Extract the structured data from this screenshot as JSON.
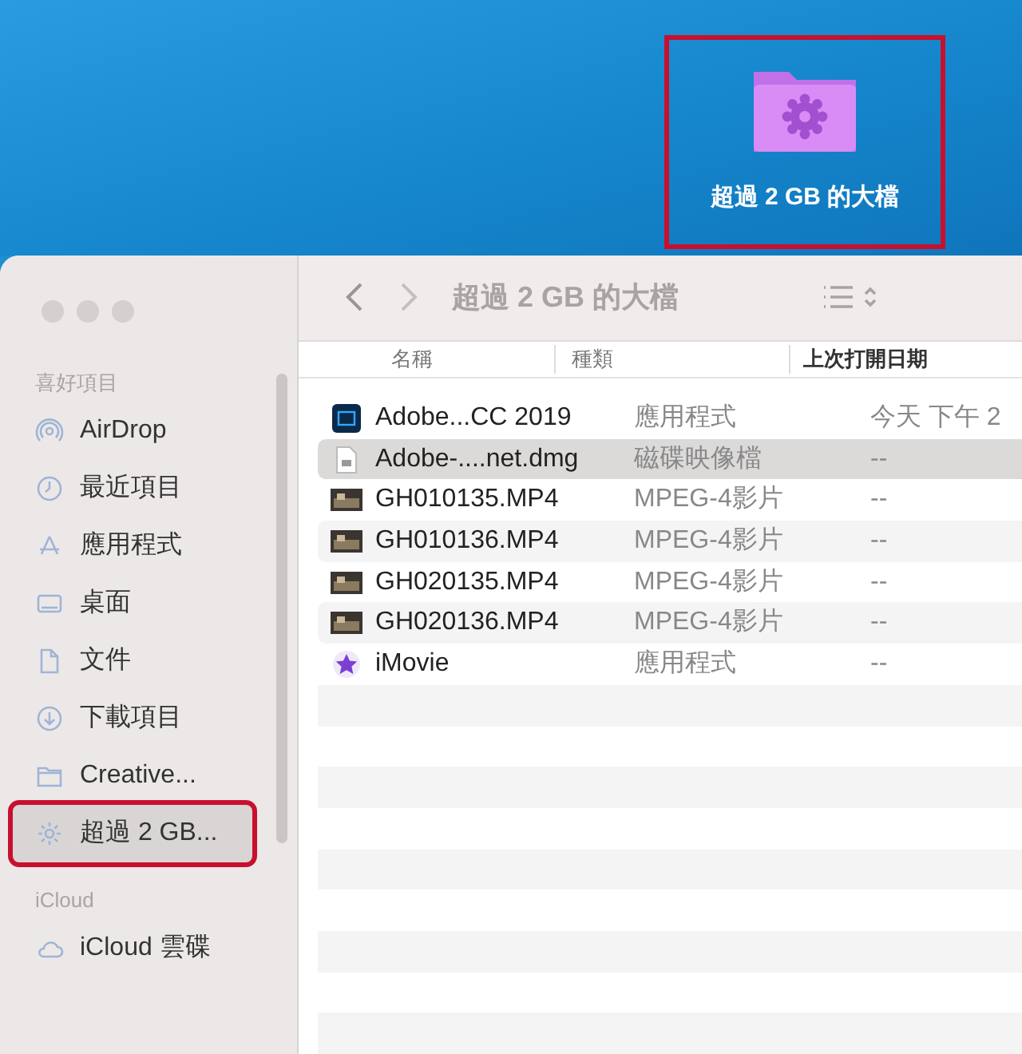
{
  "desktop": {
    "folder": {
      "label": "超過 2 GB 的大檔",
      "highlighted": true
    }
  },
  "window": {
    "title": "超過 2 GB 的大檔"
  },
  "sidebar": {
    "sections": [
      {
        "heading": "喜好項目",
        "items": [
          {
            "label": "AirDrop",
            "selected": false,
            "highlighted": false
          },
          {
            "label": "最近項目",
            "selected": false,
            "highlighted": false
          },
          {
            "label": "應用程式",
            "selected": false,
            "highlighted": false
          },
          {
            "label": "桌面",
            "selected": false,
            "highlighted": false
          },
          {
            "label": "文件",
            "selected": false,
            "highlighted": false
          },
          {
            "label": "下載項目",
            "selected": false,
            "highlighted": false
          },
          {
            "label": "Creative...",
            "selected": false,
            "highlighted": false
          },
          {
            "label": "超過 2 GB...",
            "selected": true,
            "highlighted": true
          }
        ]
      },
      {
        "heading": "iCloud",
        "items": [
          {
            "label": "iCloud 雲碟",
            "selected": false,
            "highlighted": false
          }
        ]
      }
    ]
  },
  "table": {
    "columns": [
      "名稱",
      "種類",
      "上次打開日期"
    ],
    "rows": [
      {
        "name": "Adobe...CC 2019",
        "kind": "應用程式",
        "opened": "今天 下午 2",
        "selected": false
      },
      {
        "name": "Adobe-....net.dmg",
        "kind": "磁碟映像檔",
        "opened": "--",
        "selected": true
      },
      {
        "name": "GH010135.MP4",
        "kind": "MPEG-4影片",
        "opened": "--",
        "selected": false
      },
      {
        "name": "GH010136.MP4",
        "kind": "MPEG-4影片",
        "opened": "--",
        "selected": false
      },
      {
        "name": "GH020135.MP4",
        "kind": "MPEG-4影片",
        "opened": "--",
        "selected": false
      },
      {
        "name": "GH020136.MP4",
        "kind": "MPEG-4影片",
        "opened": "--",
        "selected": false
      },
      {
        "name": "iMovie",
        "kind": "應用程式",
        "opened": "--",
        "selected": false
      }
    ]
  }
}
